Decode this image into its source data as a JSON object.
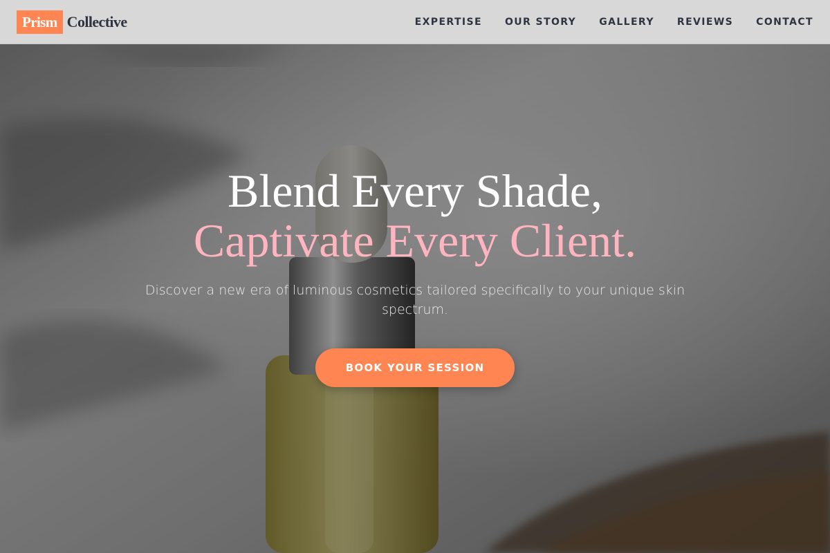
{
  "brand": {
    "badge": "Prism",
    "name": "Collective"
  },
  "nav": {
    "items": [
      {
        "label": "EXPERTISE"
      },
      {
        "label": "OUR STORY"
      },
      {
        "label": "GALLERY"
      },
      {
        "label": "REVIEWS"
      },
      {
        "label": "CONTACT"
      }
    ]
  },
  "hero": {
    "headline_line1": "Blend Every Shade,",
    "headline_line2": "Captivate Every Client.",
    "subtitle": "Discover a new era of luminous cosmetics tailored specifically to your unique skin spectrum.",
    "cta_label": "BOOK YOUR SESSION",
    "background": "serum-dropper-bottle-photo"
  },
  "colors": {
    "accent": "#ff8552",
    "headline_accent": "#ffb5c0",
    "nav_bg": "#d8d8d8",
    "nav_text": "#2e3440"
  }
}
